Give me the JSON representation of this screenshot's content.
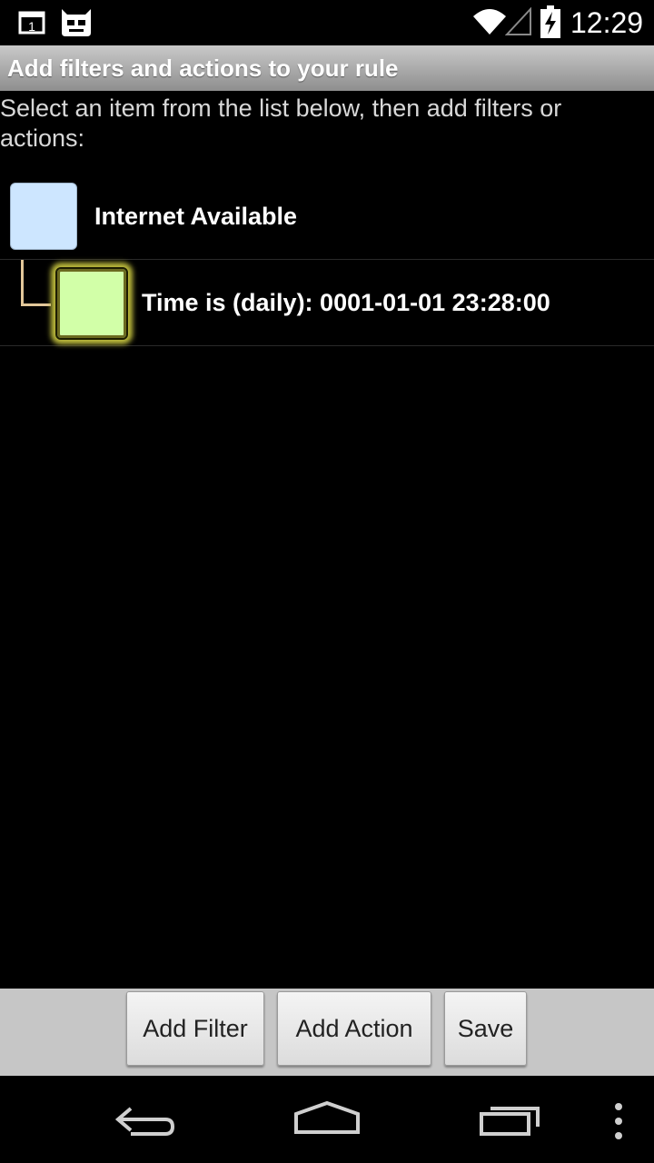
{
  "status_bar": {
    "time": "12:29",
    "icons": [
      "calendar-notification-icon",
      "cyanogenmod-icon",
      "wifi-icon",
      "signal-icon",
      "battery-charging-icon"
    ],
    "calendar_day": "1"
  },
  "title_bar": {
    "title": "Add filters and actions to your rule"
  },
  "instruction": "Select an item from the list below, then add filters or actions:",
  "rule_items": [
    {
      "label": "Internet Available",
      "color": "#cde6ff",
      "selected": false
    },
    {
      "label": "Time is (daily): 0001-01-01 23:28:00",
      "color": "#d2ffa8",
      "selected": true
    }
  ],
  "buttons": {
    "add_filter": "Add Filter",
    "add_action": "Add Action",
    "save": "Save"
  },
  "nav_bar": {
    "icons": [
      "back-icon",
      "home-icon",
      "recents-icon",
      "menu-icon"
    ]
  },
  "colors": {
    "title_bar": "#a9a9a9",
    "connector": "#e2c79a",
    "selection_glow": "#bcba3c"
  }
}
